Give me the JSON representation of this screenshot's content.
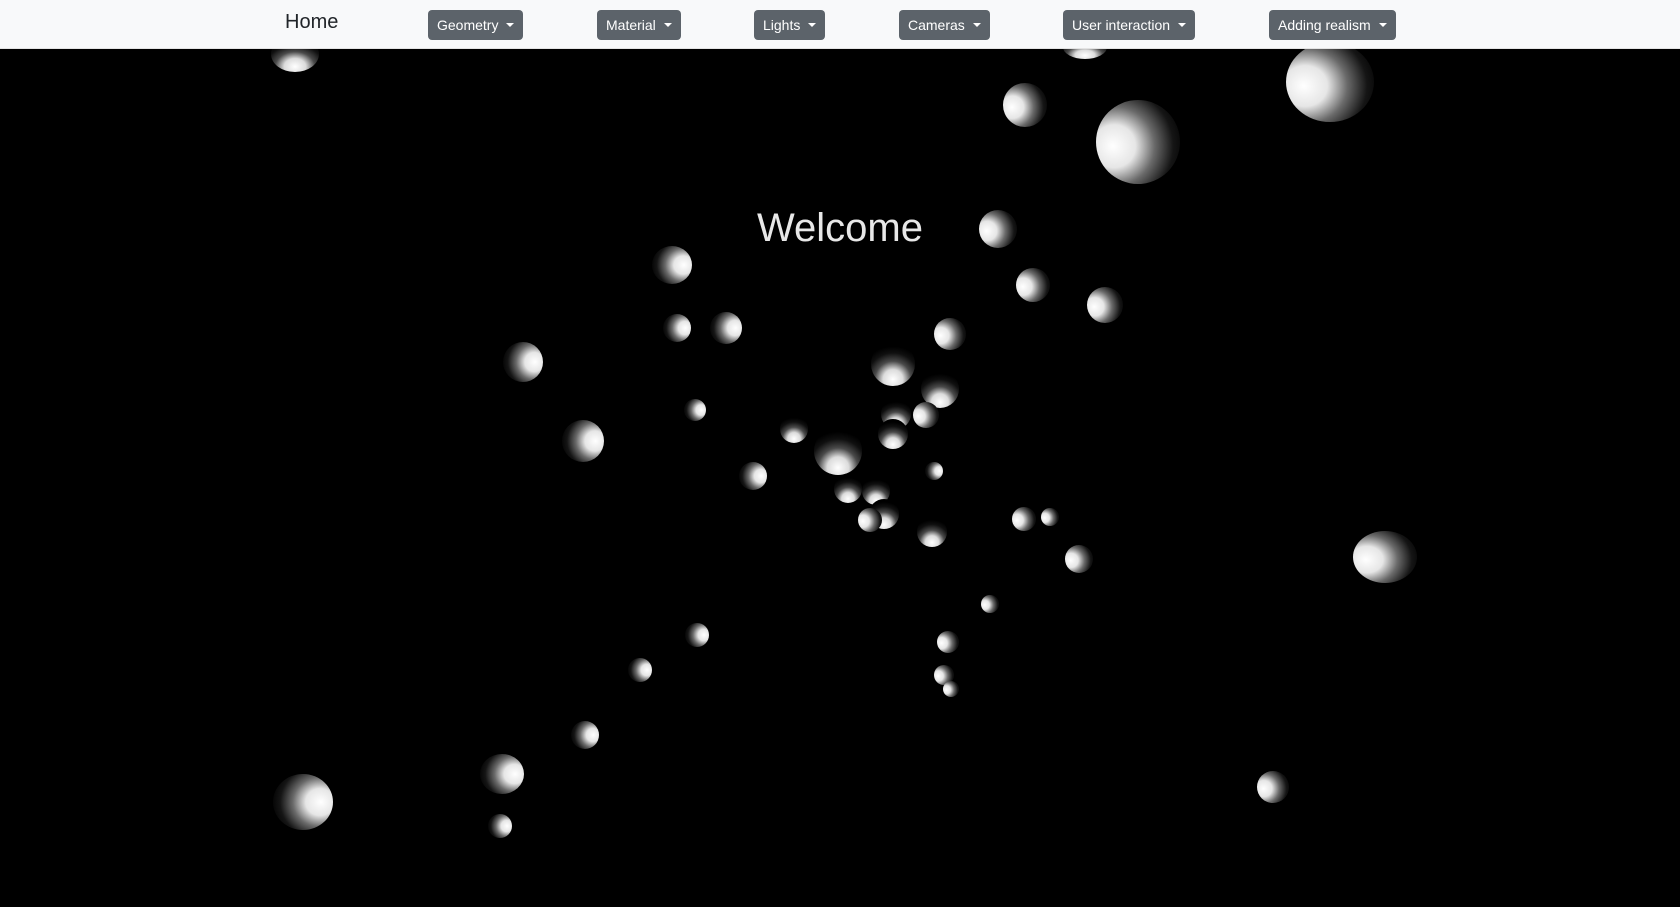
{
  "navbar": {
    "home_label": "Home",
    "menus": [
      {
        "label": "Geometry"
      },
      {
        "label": "Material"
      },
      {
        "label": "Lights"
      },
      {
        "label": "Cameras"
      },
      {
        "label": "User interaction"
      },
      {
        "label": "Adding realism"
      }
    ]
  },
  "scene": {
    "heading": "Welcome",
    "background_color": "#000000",
    "sphere_color": "#ffffff"
  }
}
